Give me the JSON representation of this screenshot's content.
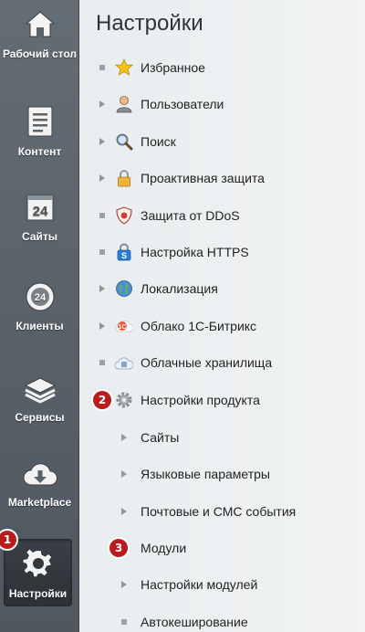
{
  "sidebar": {
    "items": [
      {
        "label": "Рабочий стол",
        "icon": "home-icon"
      },
      {
        "label": "Контент",
        "icon": "document-icon"
      },
      {
        "label": "Сайты",
        "icon": "calendar-24-icon"
      },
      {
        "label": "Клиенты",
        "icon": "clients-24-icon"
      },
      {
        "label": "Сервисы",
        "icon": "layers-icon"
      },
      {
        "label": "Marketplace",
        "icon": "cloud-download-icon"
      },
      {
        "label": "Настройки",
        "icon": "gear-icon",
        "active": true
      }
    ]
  },
  "badges": {
    "b1": "1",
    "b2": "2",
    "b3": "3"
  },
  "main": {
    "title": "Настройки",
    "menu": [
      {
        "label": "Избранное",
        "icon": "star-icon",
        "marker": "bullet"
      },
      {
        "label": "Пользователи",
        "icon": "user-icon",
        "marker": "triangle"
      },
      {
        "label": "Поиск",
        "icon": "magnifier-icon",
        "marker": "triangle"
      },
      {
        "label": "Проактивная защита",
        "icon": "padlock-icon",
        "marker": "triangle"
      },
      {
        "label": "Защита от DDoS",
        "icon": "shield-icon",
        "marker": "bullet"
      },
      {
        "label": "Настройка HTTPS",
        "icon": "lock-s-icon",
        "marker": "bullet"
      },
      {
        "label": "Локализация",
        "icon": "globe-icon",
        "marker": "triangle"
      },
      {
        "label": "Облако 1С-Битрикс",
        "icon": "bitrix-cloud-icon",
        "marker": "triangle"
      },
      {
        "label": "Облачные хранилища",
        "icon": "cloud-storage-icon",
        "marker": "bullet"
      },
      {
        "label": "Настройки продукта",
        "icon": "gear-icon",
        "marker": "badge"
      },
      {
        "label": "Сайты",
        "marker": "triangle"
      },
      {
        "label": "Языковые параметры",
        "marker": "triangle"
      },
      {
        "label": "Почтовые и СМС события",
        "marker": "triangle"
      },
      {
        "label": "Модули",
        "marker": "badge"
      },
      {
        "label": "Настройки модулей",
        "marker": "triangle"
      },
      {
        "label": "Автокеширование",
        "marker": "bullet"
      }
    ]
  },
  "colors": {
    "badge": "#b81c1c",
    "sidebar": "#5a626a",
    "panel": "#eef1f2"
  }
}
